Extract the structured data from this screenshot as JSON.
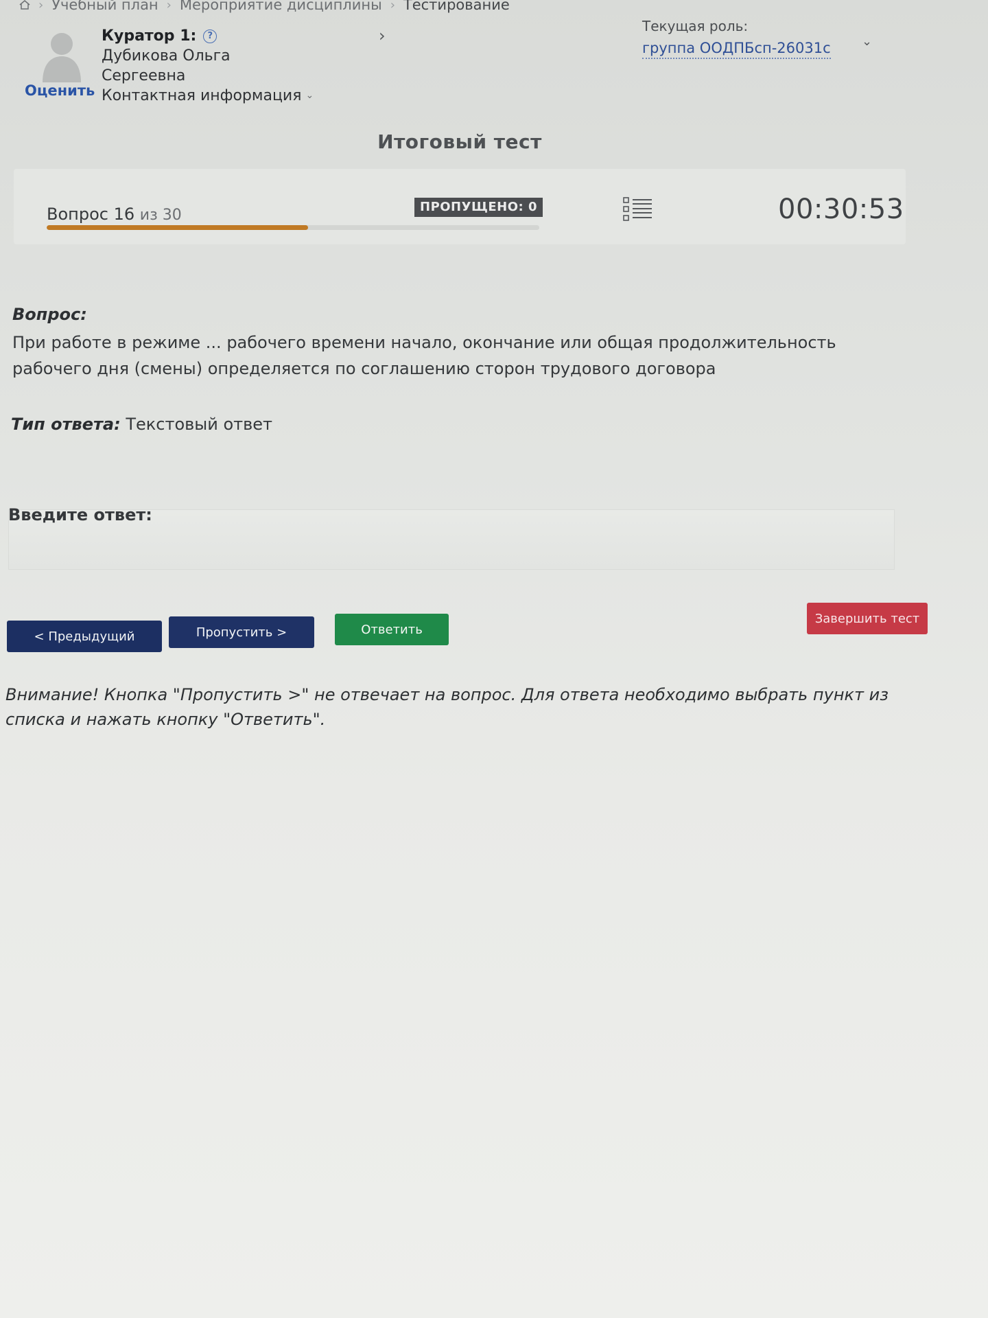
{
  "breadcrumb": {
    "items": [
      "Учебный план",
      "Мероприятие дисциплины",
      "Тестирование"
    ]
  },
  "curator": {
    "title": "Куратор 1:",
    "name_line1": "Дубикова Ольга",
    "name_line2": "Сергеевна",
    "contact_label": "Контактная информация",
    "rate_label": "Оценить",
    "next_glyph": "›"
  },
  "role": {
    "label": "Текущая роль:",
    "value": "группа ООДПБсп-26031с"
  },
  "test": {
    "title": "Итоговый тест"
  },
  "status": {
    "question_word": "Вопрос",
    "current": "16",
    "of_text": "из 30",
    "progress": 0.53,
    "skipped_label": "ПРОПУЩЕНО: 0",
    "timer": "00:30:53"
  },
  "question": {
    "label": "Вопрос:",
    "text": "При работе в режиме ... рабочего времени начало, окончание или общая продолжительность рабочего дня (смены) определяется по соглашению сторон трудового договора",
    "answer_type_label": "Тип ответа:",
    "answer_type_value": "Текстовый ответ"
  },
  "answer": {
    "label": "Введите ответ:",
    "value": ""
  },
  "buttons": {
    "prev": "< Предыдущий",
    "skip": "Пропустить >",
    "answer": "Ответить",
    "finish": "Завершить тест"
  },
  "warning": {
    "text": "Внимание! Кнопка \"Пропустить >\" не отвечает на вопрос. Для ответа необходимо выбрать пункт из списка и нажать кнопку \"Ответить\"."
  },
  "colors": {
    "primary_dark": "#1c2f62",
    "answer_green": "#1f8a49",
    "finish_red": "#c63a46",
    "progress": "#c07a24",
    "link_blue": "#2a54a6"
  },
  "icons": [
    "home-icon",
    "help-icon",
    "chevron-down-icon",
    "list-icon",
    "avatar-icon"
  ]
}
